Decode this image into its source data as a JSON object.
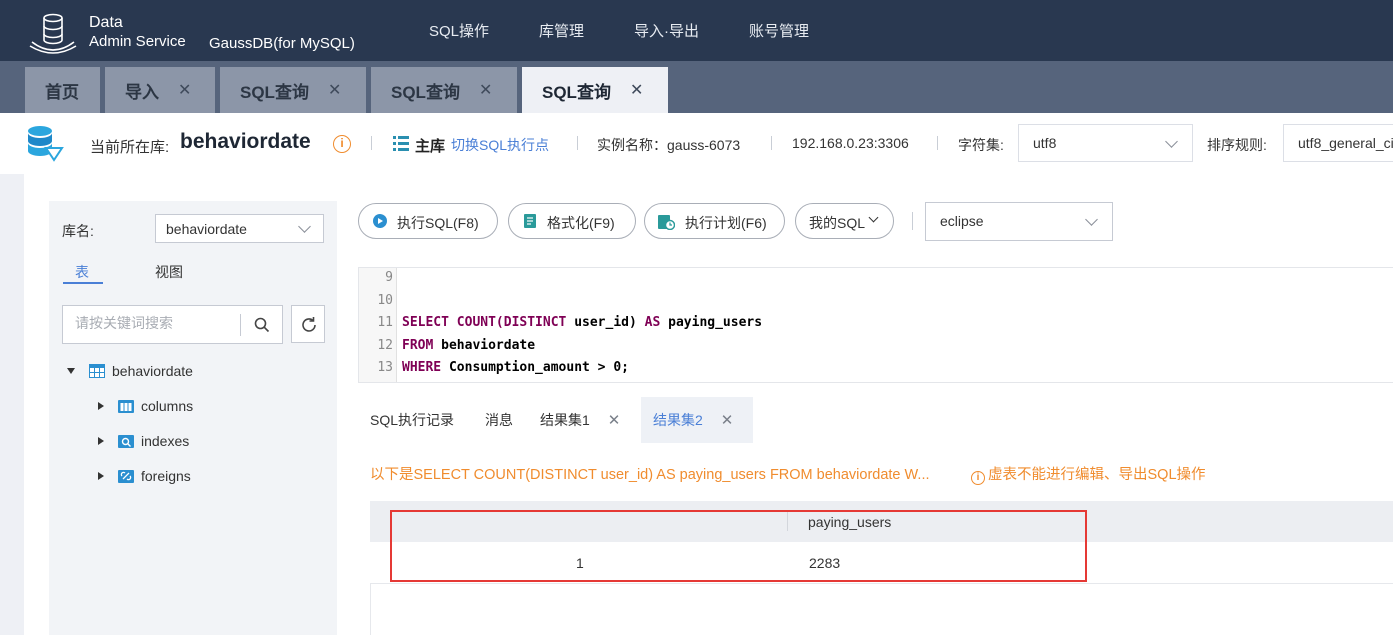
{
  "header": {
    "logo_title": "Data",
    "logo_subtitle": "Admin Service",
    "db_engine": "GaussDB(for MySQL)",
    "nav": [
      "SQL操作",
      "库管理",
      "导入·导出",
      "账号管理"
    ]
  },
  "tabs": [
    {
      "label": "首页",
      "closable": false,
      "active": false
    },
    {
      "label": "导入",
      "closable": true,
      "active": false
    },
    {
      "label": "SQL查询",
      "closable": true,
      "active": false
    },
    {
      "label": "SQL查询",
      "closable": true,
      "active": false
    },
    {
      "label": "SQL查询",
      "closable": true,
      "active": true
    }
  ],
  "infobar": {
    "current_db_label": "当前所在库:",
    "current_db": "behaviordate",
    "info_icon": "i",
    "master_label": "主库",
    "switch_link": "切换SQL执行点",
    "instance": "实例名称：gauss-6073",
    "ip": "192.168.0.23:3306",
    "charset_label": "字符集:",
    "charset_value": "utf8",
    "collation_label": "排序规则:",
    "collation_value": "utf8_general_ci"
  },
  "sidebar": {
    "db_label": "库名:",
    "db_value": "behaviordate",
    "tabs": [
      "表",
      "视图"
    ],
    "search_placeholder": "请按关键词搜索",
    "tree": {
      "root": "behaviordate",
      "children": [
        "columns",
        "indexes",
        "foreigns"
      ]
    }
  },
  "toolbar": {
    "execute": "执行SQL(F8)",
    "format": "格式化(F9)",
    "plan": "执行计划(F6)",
    "my_sql": "我的SQL",
    "theme": "eclipse"
  },
  "editor": {
    "line_numbers": [
      "9",
      "10",
      "11",
      "12",
      "13"
    ],
    "lines": [
      {
        "kw": "",
        "rest": ""
      },
      {
        "kw": "",
        "rest": ""
      },
      {
        "kw": "SELECT COUNT(DISTINCT",
        "rest": " user_id) ",
        "kw2": "AS",
        "rest2": " paying_users"
      },
      {
        "kw": "FROM",
        "rest": " behaviordate"
      },
      {
        "kw": "WHERE",
        "rest": " Consumption_amount > ",
        "num": "0",
        "tail": ";"
      }
    ]
  },
  "result_tabs": [
    {
      "label": "SQL执行记录",
      "closable": false,
      "active": false
    },
    {
      "label": "消息",
      "closable": false,
      "active": false
    },
    {
      "label": "结果集1",
      "closable": true,
      "active": false
    },
    {
      "label": "结果集2",
      "closable": true,
      "active": true
    }
  ],
  "notice": {
    "text": "以下是SELECT COUNT(DISTINCT user_id) AS paying_users FROM behaviordate W...",
    "warning": "虚表不能进行编辑、导出SQL操作",
    "warning_icon": "i"
  },
  "grid": {
    "columns": [
      "",
      "paying_users"
    ],
    "rows": [
      [
        "1",
        "2283"
      ]
    ]
  },
  "colors": {
    "topbar": "#293850",
    "tabbar": "#56647c",
    "accent": "#4a7fd6",
    "warning": "#f08c2e",
    "highlight": "#e53935"
  }
}
